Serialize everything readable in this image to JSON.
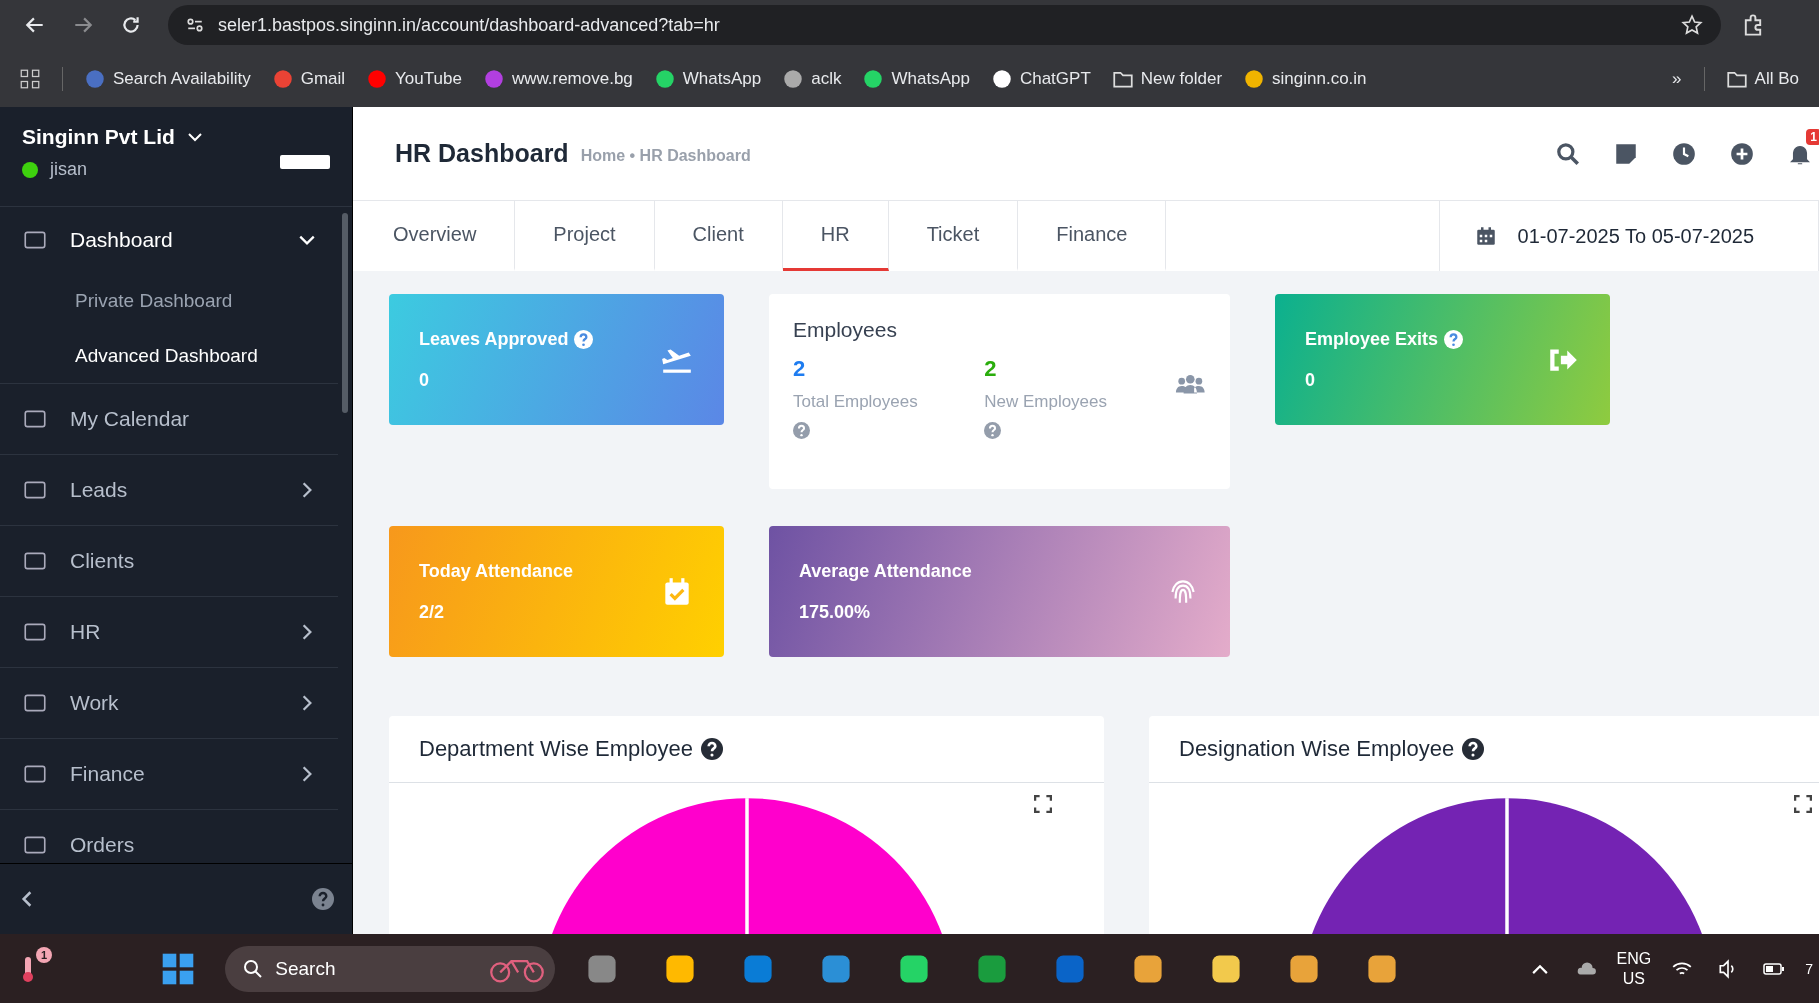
{
  "browser": {
    "url": "seler1.bastpos.singinn.in/account/dashboard-advanced?tab=hr",
    "bookmarks": [
      "Search Availability",
      "Gmail",
      "YouTube",
      "www.remove.bg",
      "WhatsApp",
      "aclk",
      "WhatsApp",
      "ChatGPT",
      "New folder",
      "singinn.co.in"
    ],
    "overflow": "»",
    "all_bookmarks": "All Bo"
  },
  "sidebar": {
    "company": "Singinn Pvt Lid",
    "user": "jisan",
    "online": true,
    "items": [
      {
        "label": "Dashboard",
        "expandable": true,
        "expanded": true,
        "children": [
          {
            "label": "Private Dashboard",
            "selected": false
          },
          {
            "label": "Advanced Dashboard",
            "selected": true
          }
        ]
      },
      {
        "label": "My Calendar",
        "expandable": false,
        "expanded": false
      },
      {
        "label": "Leads",
        "expandable": true,
        "expanded": false
      },
      {
        "label": "Clients",
        "expandable": false,
        "expanded": false
      },
      {
        "label": "HR",
        "expandable": true,
        "expanded": false
      },
      {
        "label": "Work",
        "expandable": true,
        "expanded": false
      },
      {
        "label": "Finance",
        "expandable": true,
        "expanded": false
      },
      {
        "label": "Orders",
        "expandable": false,
        "expanded": false
      }
    ]
  },
  "header": {
    "title": "HR Dashboard",
    "breadcrumb": "Home • HR Dashboard",
    "notification_count": "1"
  },
  "tabs": [
    {
      "label": "Overview",
      "selected": false
    },
    {
      "label": "Project",
      "selected": false
    },
    {
      "label": "Client",
      "selected": false
    },
    {
      "label": "HR",
      "selected": true
    },
    {
      "label": "Ticket",
      "selected": false
    },
    {
      "label": "Finance",
      "selected": false
    }
  ],
  "date_range": "01-07-2025 To 05-07-2025",
  "cards": [
    {
      "kind": "stat",
      "title": "Leaves Approved",
      "help": true,
      "value": "0"
    },
    {
      "kind": "split",
      "title": "Employees",
      "stats": [
        {
          "value": "2",
          "label": "Total Employees"
        },
        {
          "value": "2",
          "label": "New Employees"
        }
      ]
    },
    {
      "kind": "stat",
      "title": "Employee Exits",
      "help": true,
      "value": "0"
    },
    {
      "kind": "stat",
      "title": "Today Attendance",
      "help": false,
      "value": "2/2"
    },
    {
      "kind": "stat",
      "title": "Average Attendance",
      "help": false,
      "value": "175.00%"
    }
  ],
  "charts": [
    {
      "title": "Department Wise Employee"
    },
    {
      "title": "Designation Wise Employee"
    }
  ],
  "taskbar": {
    "alert_count": "1",
    "search": "Search",
    "language": "ENG",
    "region": "US",
    "clock": "7"
  }
}
